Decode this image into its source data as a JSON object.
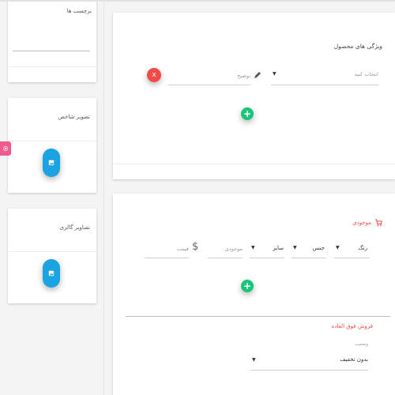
{
  "sidebar": {
    "tags_card": {
      "title": "برچسب ها"
    },
    "featured_image_card": {
      "title": "تصویر شاخص"
    },
    "gallery_card": {
      "title": "تصاویر گالری"
    },
    "settings_tab_icon": "gear-icon"
  },
  "attributes_card": {
    "title": "ویژگی های محصول",
    "select_placeholder": "انتخاب کنید",
    "description_placeholder": "توضیح",
    "remove_icon": "x"
  },
  "stock_card": {
    "title": "موجودی",
    "columns": [
      {
        "label": "رنگ"
      },
      {
        "label": "جنس"
      },
      {
        "label": "سایز"
      }
    ],
    "quantity_placeholder": "موجودی",
    "price_placeholder": "قیمت",
    "currency_symbol": "$",
    "special_sale": {
      "title": "فروش فوق العاده",
      "status_label": "وضعیت",
      "status_value": "بدون تخفیف"
    }
  },
  "colors": {
    "accent_red": "#f04b47",
    "accent_green": "#17c57a",
    "accent_blue": "#1aa3e0",
    "settings_pink": "#f05a8c"
  }
}
